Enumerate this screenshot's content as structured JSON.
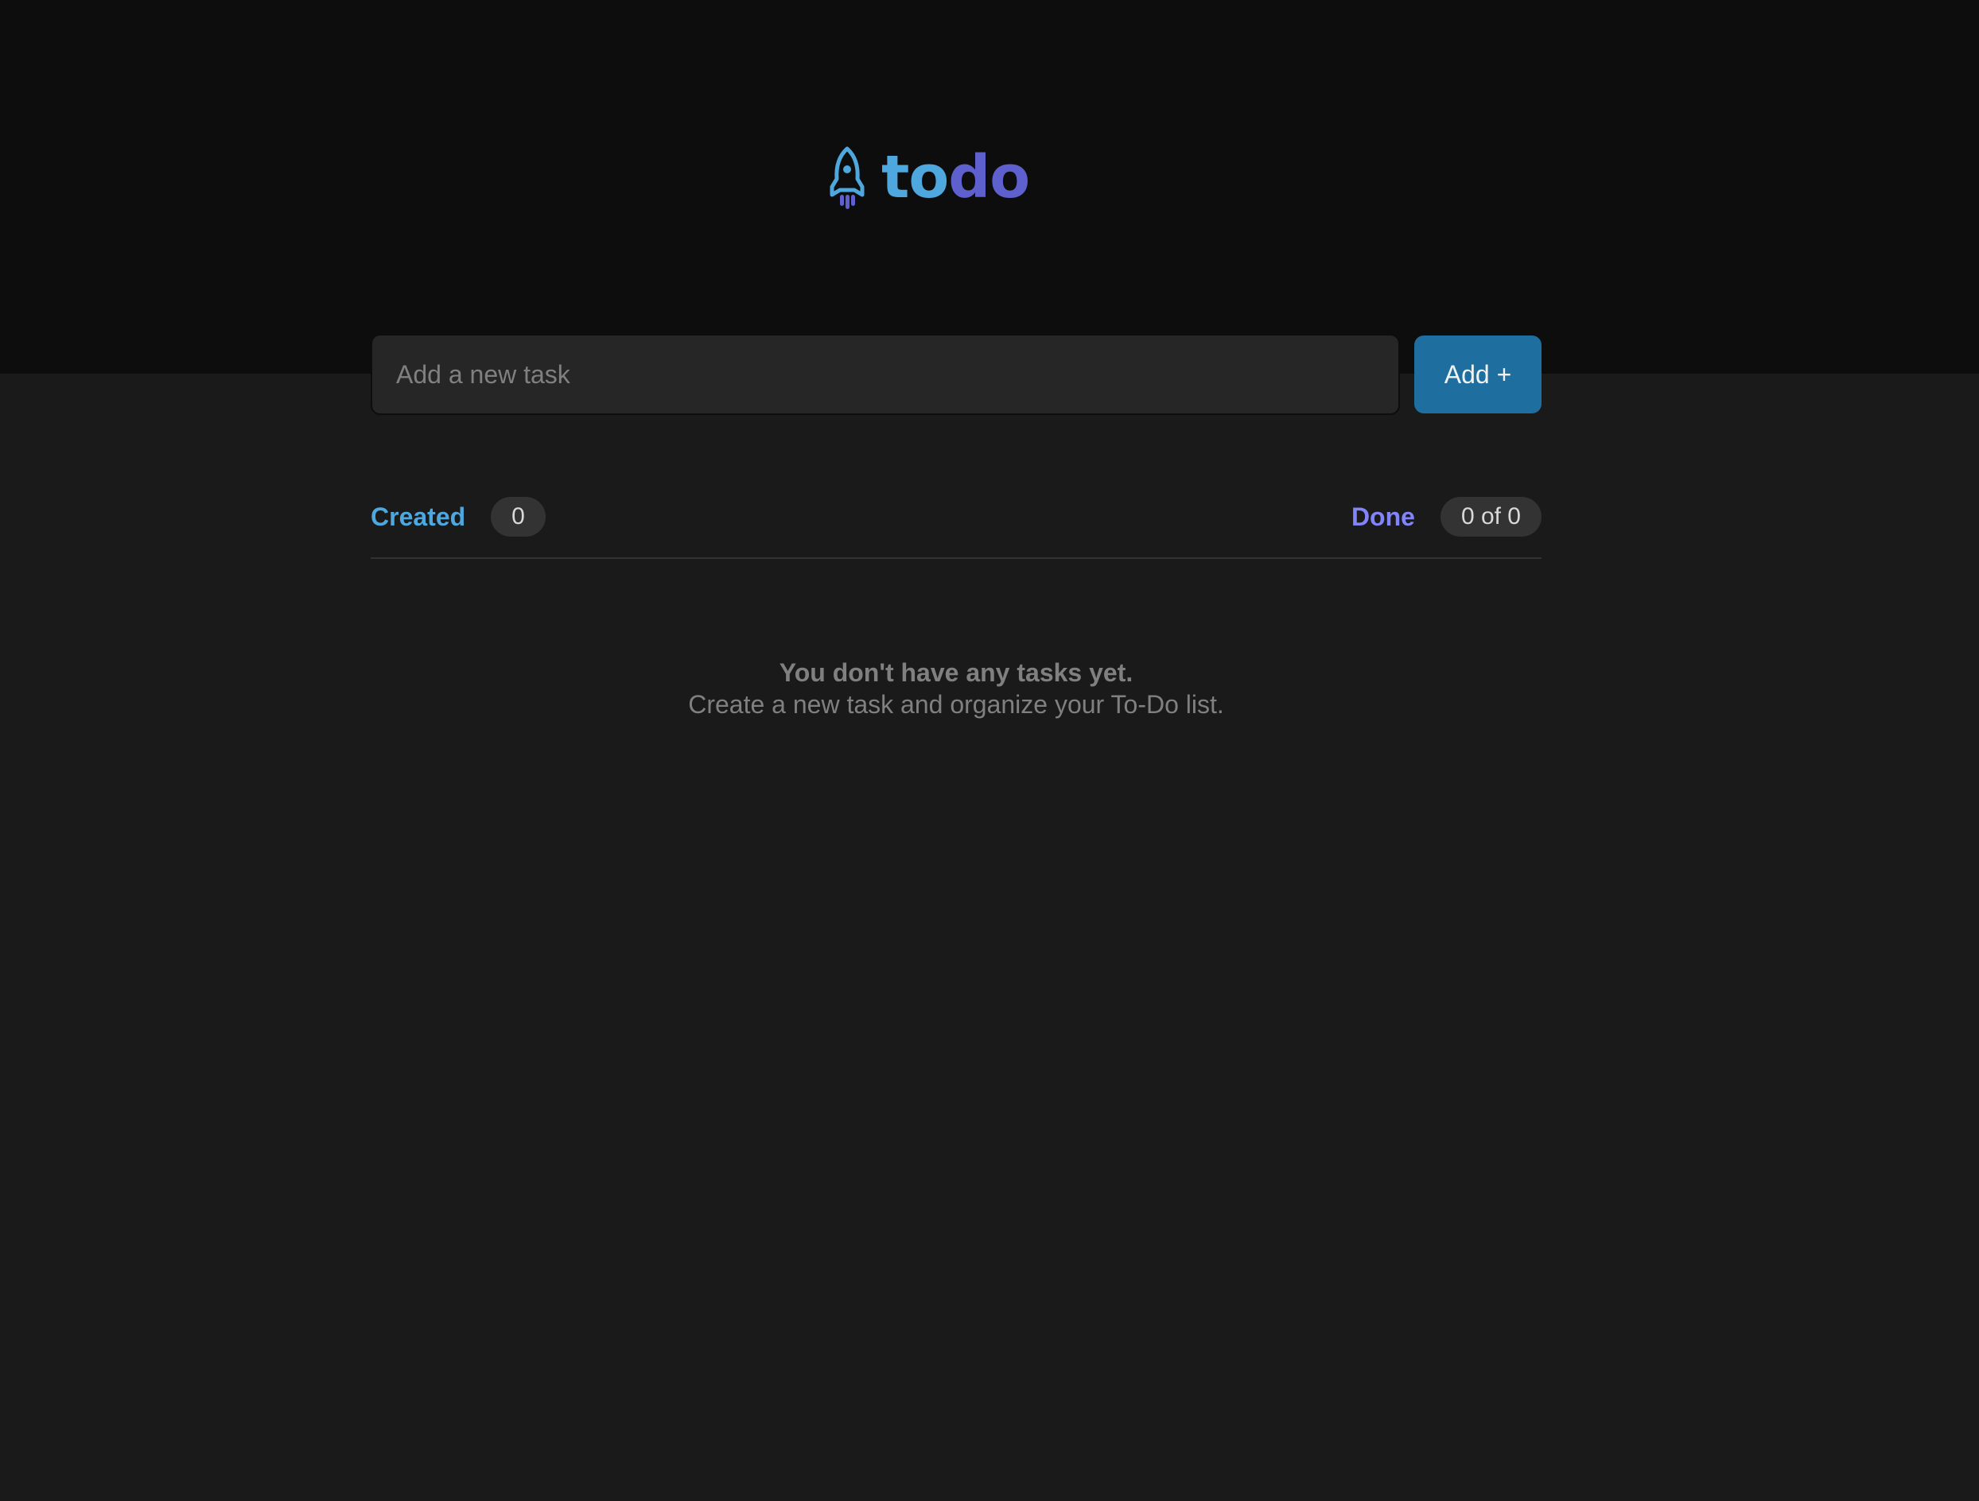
{
  "header": {
    "logo_icon": "rocket-icon",
    "logo_part1": "to",
    "logo_part2": "do"
  },
  "new_task": {
    "placeholder": "Add a new task",
    "value": "",
    "add_label": "Add +"
  },
  "stats": {
    "created_label": "Created",
    "created_count": "0",
    "done_label": "Done",
    "done_count": "0 of 0"
  },
  "empty_state": {
    "title": "You don't have any tasks yet.",
    "subtitle": "Create a new task and organize your To-Do list."
  },
  "colors": {
    "header_bg": "#0d0d0d",
    "page_bg": "#1a1a1a",
    "input_bg": "#262626",
    "button_bg": "#1e6f9f",
    "blue": "#4ea8de",
    "purple": "#5e60ce",
    "purple_light": "#8284fa",
    "badge_bg": "#333333",
    "muted_text": "#808080"
  }
}
